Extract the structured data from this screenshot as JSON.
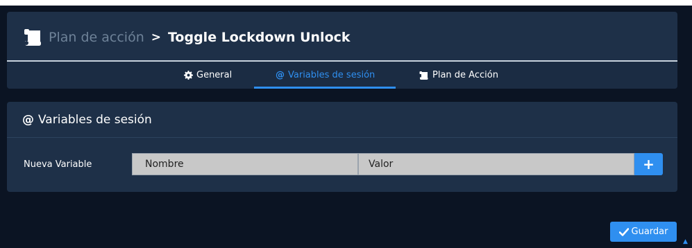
{
  "breadcrumb": {
    "parent": "Plan de acción",
    "separator": ">",
    "current": "Toggle Lockdown Unlock"
  },
  "tabs": [
    {
      "label": "General",
      "icon": "gear-icon",
      "active": false
    },
    {
      "label": "Variables de sesión",
      "icon": "at-icon",
      "active": true
    },
    {
      "label": "Plan de Acción",
      "icon": "scroll-icon",
      "active": false
    }
  ],
  "session_vars": {
    "title": "Variables de sesión",
    "new_label": "Nueva Variable",
    "name_placeholder": "Nombre",
    "value_placeholder": "Valor",
    "add_label": "+"
  },
  "footer": {
    "save_label": "Guardar"
  },
  "colors": {
    "background": "#0b1423",
    "panel": "#1e3048",
    "accent": "#2f8ff0",
    "muted_text": "#6e8298"
  }
}
